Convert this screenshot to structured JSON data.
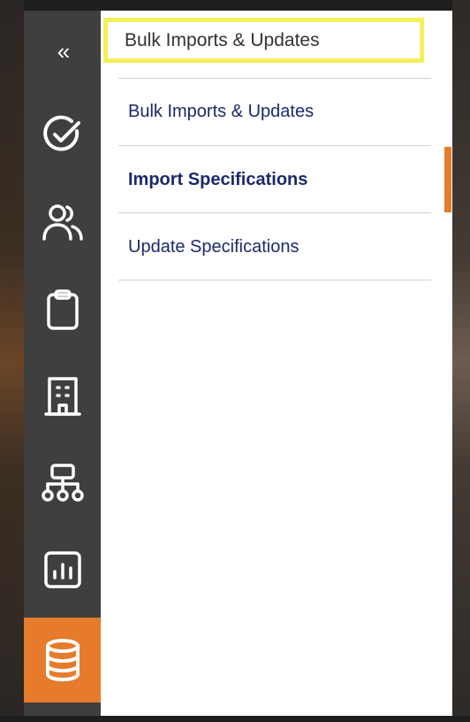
{
  "sidebar": {
    "collapse_label": "«",
    "items": [
      {
        "icon": "check-circle-icon",
        "active": false
      },
      {
        "icon": "users-icon",
        "active": false
      },
      {
        "icon": "clipboard-icon",
        "active": false
      },
      {
        "icon": "building-icon",
        "active": false
      },
      {
        "icon": "org-chart-icon",
        "active": false
      },
      {
        "icon": "report-chart-icon",
        "active": false
      },
      {
        "icon": "database-icon",
        "active": true
      }
    ]
  },
  "panel": {
    "title": "Bulk Imports & Updates",
    "links": [
      {
        "label": "Bulk Imports & Updates",
        "bold": false
      },
      {
        "label": "Import Specifications",
        "bold": true
      },
      {
        "label": "Update Specifications",
        "bold": false
      }
    ]
  },
  "colors": {
    "accent": "#e57b2b",
    "sidebar_bg": "#3f3f3f",
    "link": "#1b2a6b",
    "highlight": "#f3f05a"
  }
}
